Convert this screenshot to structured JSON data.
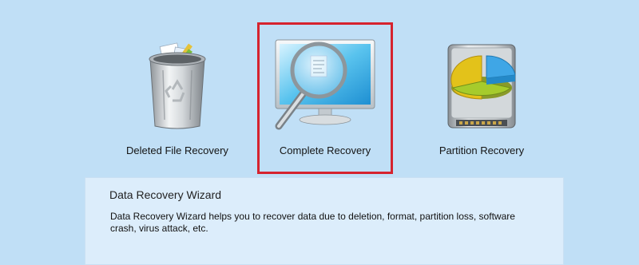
{
  "options": [
    {
      "id": "deleted",
      "label": "Deleted File Recovery",
      "icon": "recycle-bin-icon",
      "selected": false
    },
    {
      "id": "complete",
      "label": "Complete Recovery",
      "icon": "monitor-magnifier-icon",
      "selected": true
    },
    {
      "id": "partition",
      "label": "Partition Recovery",
      "icon": "hard-drive-pie-chart-icon",
      "selected": false
    }
  ],
  "wizard": {
    "title": "Data Recovery Wizard",
    "description": "Data Recovery Wizard helps you to recover data due to deletion, format, partition loss, software crash, virus attack, etc."
  },
  "colors": {
    "background": "#c0dff6",
    "panel": "#dcedfb",
    "selection_border": "#d6232e"
  }
}
